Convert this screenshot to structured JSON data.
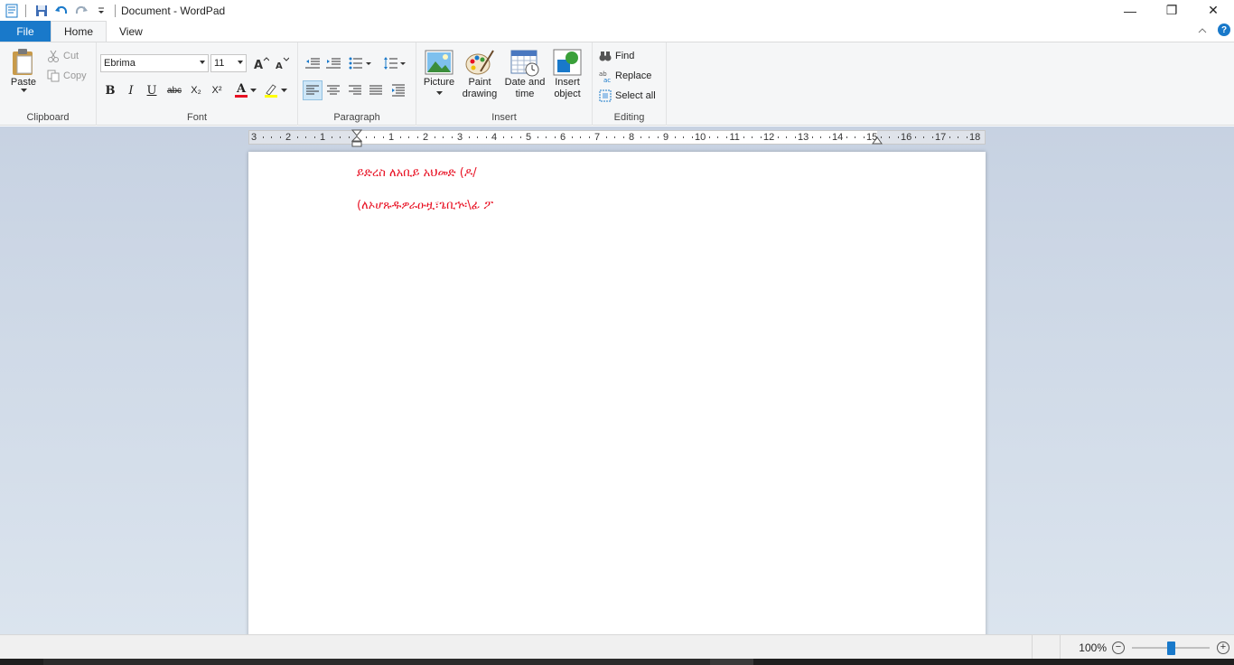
{
  "window": {
    "title": "Document - WordPad",
    "minimize_glyph": "—",
    "maximize_glyph": "❐",
    "close_glyph": "✕"
  },
  "tabs": {
    "file": "File",
    "home": "Home",
    "view": "View",
    "help": "?"
  },
  "clipboard": {
    "paste": "Paste",
    "cut": "Cut",
    "copy": "Copy",
    "group": "Clipboard"
  },
  "font": {
    "family": "Ebrima",
    "size": "11",
    "group": "Font",
    "bold": "B",
    "italic": "I",
    "underline": "U",
    "strikethrough": "abc",
    "subscript": "X₂",
    "superscript": "X²",
    "color_letter": "A",
    "font_color": "#e81123",
    "highlight_color": "#ffff00"
  },
  "paragraph": {
    "group": "Paragraph"
  },
  "insert": {
    "group": "Insert",
    "picture": "Picture",
    "paint_line1": "Paint",
    "paint_line2": "drawing",
    "date_line1": "Date and",
    "date_line2": "time",
    "object_line1": "Insert",
    "object_line2": "object"
  },
  "editing": {
    "group": "Editing",
    "find": "Find",
    "replace": "Replace",
    "select_all": "Select all"
  },
  "ruler": {
    "left_labels": [
      "3",
      "2",
      "1"
    ],
    "right_labels": [
      "1",
      "2",
      "3",
      "4",
      "5",
      "6",
      "7",
      "8",
      "9",
      "10",
      "11",
      "12",
      "13",
      "14",
      "15",
      "16",
      "17",
      "18"
    ]
  },
  "document": {
    "line1": "ይድረስ ለአቢይ አህመድ (ዶ/",
    "line2": "(ለኦሆጹዱዎራዑዟ፣ጌቢኍ፡\\ፊ ፖ",
    "text_color": "#e81123"
  },
  "status": {
    "zoom": "100%",
    "zoom_out": "−",
    "zoom_in": "+",
    "zoom_level": 0.5
  },
  "colors": {
    "accent": "#1979ca"
  }
}
